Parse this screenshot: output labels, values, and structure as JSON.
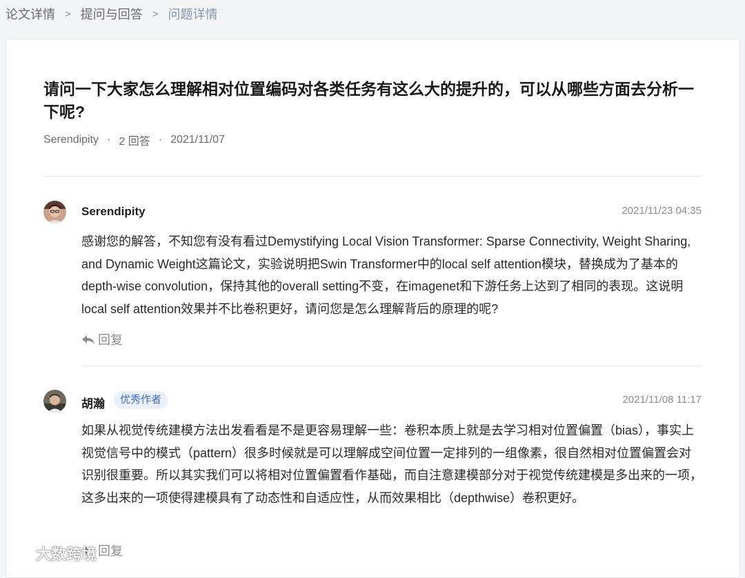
{
  "breadcrumb": {
    "items": [
      "论文详情",
      "提问与回答"
    ],
    "current": "问题详情",
    "separator": ">"
  },
  "question": {
    "title": "请问一下大家怎么理解相对位置编码对各类任务有这么大的提升的，可以从哪些方面去分析一下呢?",
    "author": "Serendipity",
    "dot": "·",
    "answer_count": "2 回答",
    "date": "2021/11/07"
  },
  "answers": [
    {
      "author": "Serendipity",
      "time": "2021/11/23 04:35",
      "content": "感谢您的解答，不知您有没有看过Demystifying Local Vision Transformer: Sparse Connectivity, Weight Sharing, and Dynamic Weight这篇论文，实验说明把Swin Transformer中的local self attention模块，替换成为了基本的depth-wise convolution，保持其他的overall setting不变，在imagenet和下游任务上达到了相同的表现。这说明local self attention效果并不比卷积更好，请问您是怎么理解背后的原理的呢?",
      "reply_label": "回复"
    },
    {
      "author": "胡瀚",
      "badge": "优秀作者",
      "time": "2021/11/08 11:17",
      "content": "如果从视觉传统建模方法出发看看是不是更容易理解一些：卷积本质上就是去学习相对位置偏置（bias），事实上视觉信号中的模式（pattern）很多时候就是可以理解成空间位置一定排列的一组像素，很自然相对位置偏置会对识别很重要。所以其实我们可以将相对位置偏置看作基础，而自注意建模部分对于视觉传统建模是多出来的一项，这多出来的一项使得建模具有了动态性和自适应性，从而效果相比（depthwise）卷积更好。",
      "reply_label": "回复"
    }
  ],
  "watermark": "大数跨境",
  "icons": {
    "reply": "reply-arrow-icon",
    "watermark_logo": "wechat-logo-icon"
  },
  "colors": {
    "background": "#f3f4f6",
    "badge_text": "#3b6fd6",
    "badge_bg": "#eaf1fd",
    "muted": "#8c8c8c"
  }
}
